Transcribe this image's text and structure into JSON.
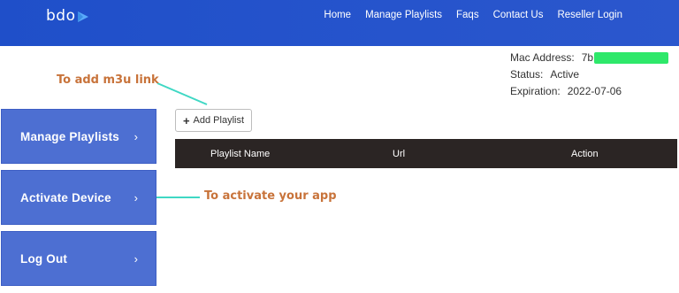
{
  "header": {
    "logo_text": "bdo",
    "nav": [
      "Home",
      "Manage Playlists",
      "Faqs",
      "Contact Us",
      "Reseller Login"
    ]
  },
  "device_info": {
    "mac_label": "Mac Address:",
    "mac_value_visible": "7b",
    "status_label": "Status:",
    "status_value": "Active",
    "expiration_label": "Expiration:",
    "expiration_value": "2022-07-06"
  },
  "annotations": {
    "add_m3u": "To add m3u link",
    "activate_app": "To activate your app"
  },
  "sidebar": {
    "items": [
      {
        "label": "Manage Playlists",
        "chevron": "›"
      },
      {
        "label": "Activate Device",
        "chevron": "›"
      },
      {
        "label": "Log Out",
        "chevron": "›"
      }
    ]
  },
  "playlist": {
    "add_button_label": "Add Playlist",
    "add_button_icon": "plus-icon",
    "columns": [
      "Playlist Name",
      "Url",
      "Action"
    ],
    "rows": []
  },
  "colors": {
    "navbar": "#2654cc",
    "sidebar_button": "#4d6fd2",
    "table_header": "#2b2524",
    "annotation_text": "#c8733a",
    "annotation_line": "#3fd8c4",
    "mac_redaction": "#2ee86a"
  }
}
